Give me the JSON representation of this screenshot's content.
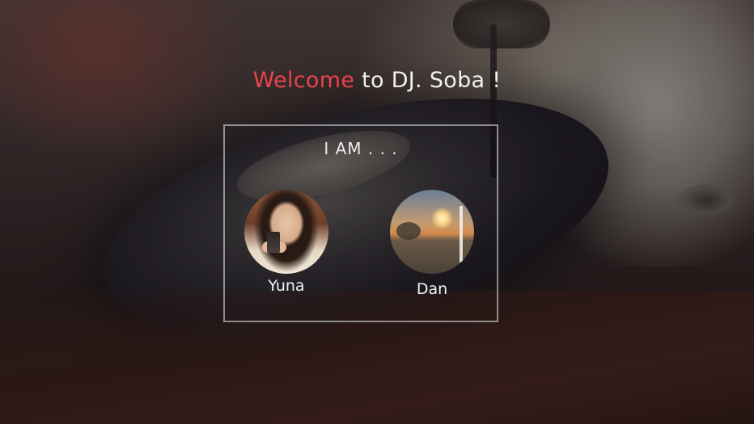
{
  "header": {
    "welcome_word": "Welcome",
    "welcome_rest": " to DJ. Soba !",
    "accent_color": "#e8434e"
  },
  "selector": {
    "prompt": "I AM . . .",
    "profiles": [
      {
        "name": "Yuna"
      },
      {
        "name": "Dan"
      }
    ]
  },
  "background": {
    "subject": "blurred vinyl record turntable"
  }
}
